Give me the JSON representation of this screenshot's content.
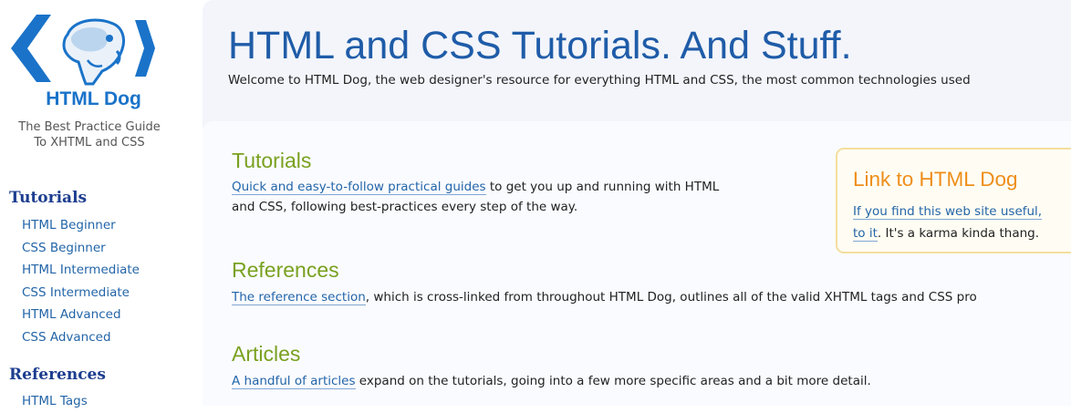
{
  "sidebar": {
    "brand_name": "HTML Dog",
    "tagline_line1": "The Best Practice Guide",
    "tagline_line2": "To XHTML and CSS",
    "logo_icon": "dog-head-chevrons-logo",
    "sections": [
      {
        "heading": "Tutorials",
        "items": [
          {
            "label": "HTML Beginner"
          },
          {
            "label": "CSS Beginner"
          },
          {
            "label": "HTML Intermediate"
          },
          {
            "label": "CSS Intermediate"
          },
          {
            "label": "HTML Advanced"
          },
          {
            "label": "CSS Advanced"
          }
        ]
      },
      {
        "heading": "References",
        "items": [
          {
            "label": "HTML Tags"
          }
        ]
      }
    ]
  },
  "main": {
    "title": "HTML and CSS Tutorials. And Stuff.",
    "intro": "Welcome to HTML Dog, the web designer's resource for everything HTML and CSS, the most common technologies used",
    "sections": [
      {
        "title": "Tutorials",
        "link_text": "Quick and easy-to-follow practical guides",
        "text_after_link": " to get you up and running with HTML",
        "line2": "and CSS, following best-practices every step of the way."
      },
      {
        "title": "References",
        "link_text": "The reference section",
        "text_after_link": ", which is cross-linked from throughout HTML Dog, outlines all of the valid XHTML tags and CSS pro"
      },
      {
        "title": "Articles",
        "link_text": "A handful of articles",
        "text_after_link": " expand on the tutorials, going into a few more specific areas and a bit more detail."
      }
    ],
    "linkbox": {
      "title": "Link to HTML Dog",
      "line1_link": "If you find this web site useful,",
      "line2_link": "to it",
      "line2_rest": ". It's a karma kinda thang."
    }
  },
  "colors": {
    "brand_blue": "#1a73c9",
    "title_blue": "#1f5ca8",
    "link_blue": "#2365a8",
    "section_green": "#79a11f",
    "linkbox_orange": "#ee8e1b",
    "sidebar_heading": "#1c3d8f"
  }
}
